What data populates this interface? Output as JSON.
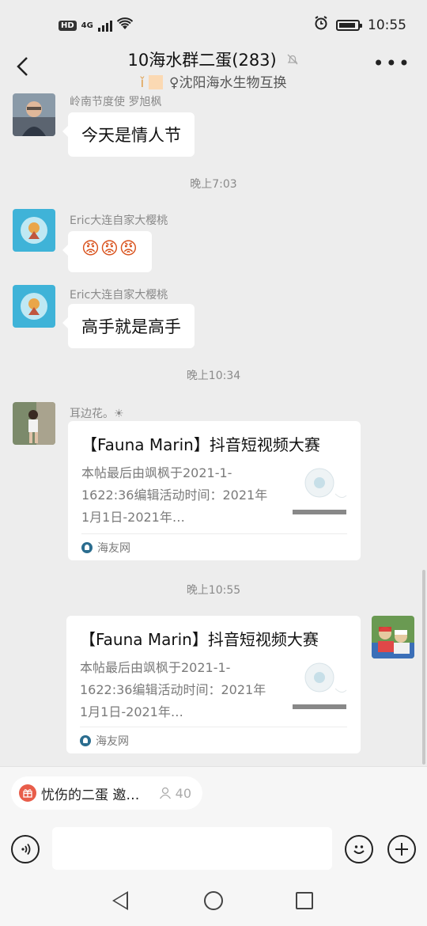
{
  "status_bar": {
    "network_badge": "HD",
    "network_type": "4G",
    "time": "10:55"
  },
  "header": {
    "title": "10海水群二蛋(283)",
    "subtitle": "♀沈阳海水生物互换"
  },
  "messages": [
    {
      "sender": "岭南节度使 罗旭枫",
      "text": "今天是情人节"
    },
    {
      "timestamp": "晚上7:03"
    },
    {
      "sender": "Eric大连自家大樱桃",
      "text": "😡😡😡"
    },
    {
      "sender": "Eric大连自家大樱桃",
      "text": "高手就是高手"
    },
    {
      "timestamp": "晚上10:34"
    },
    {
      "sender": "耳边花。☀",
      "card": {
        "title": "【Fauna Marin】抖音短视频大赛",
        "desc": "本帖最后由飒枫于2021-1-1622:36编辑活动时间：2021年1月1日-2021年…",
        "source": "海友网"
      }
    },
    {
      "timestamp": "晚上10:55"
    },
    {
      "card": {
        "title": "【Fauna Marin】抖音短视频大赛",
        "desc": "本帖最后由飒枫于2021-1-1622:36编辑活动时间：2021年1月1日-2021年…",
        "source": "海友网"
      }
    }
  ],
  "bottom": {
    "pill_text": "忧伤的二蛋 邀…",
    "pill_count": "40"
  },
  "colors": {
    "background": "#ededed",
    "bubble": "#ffffff"
  }
}
